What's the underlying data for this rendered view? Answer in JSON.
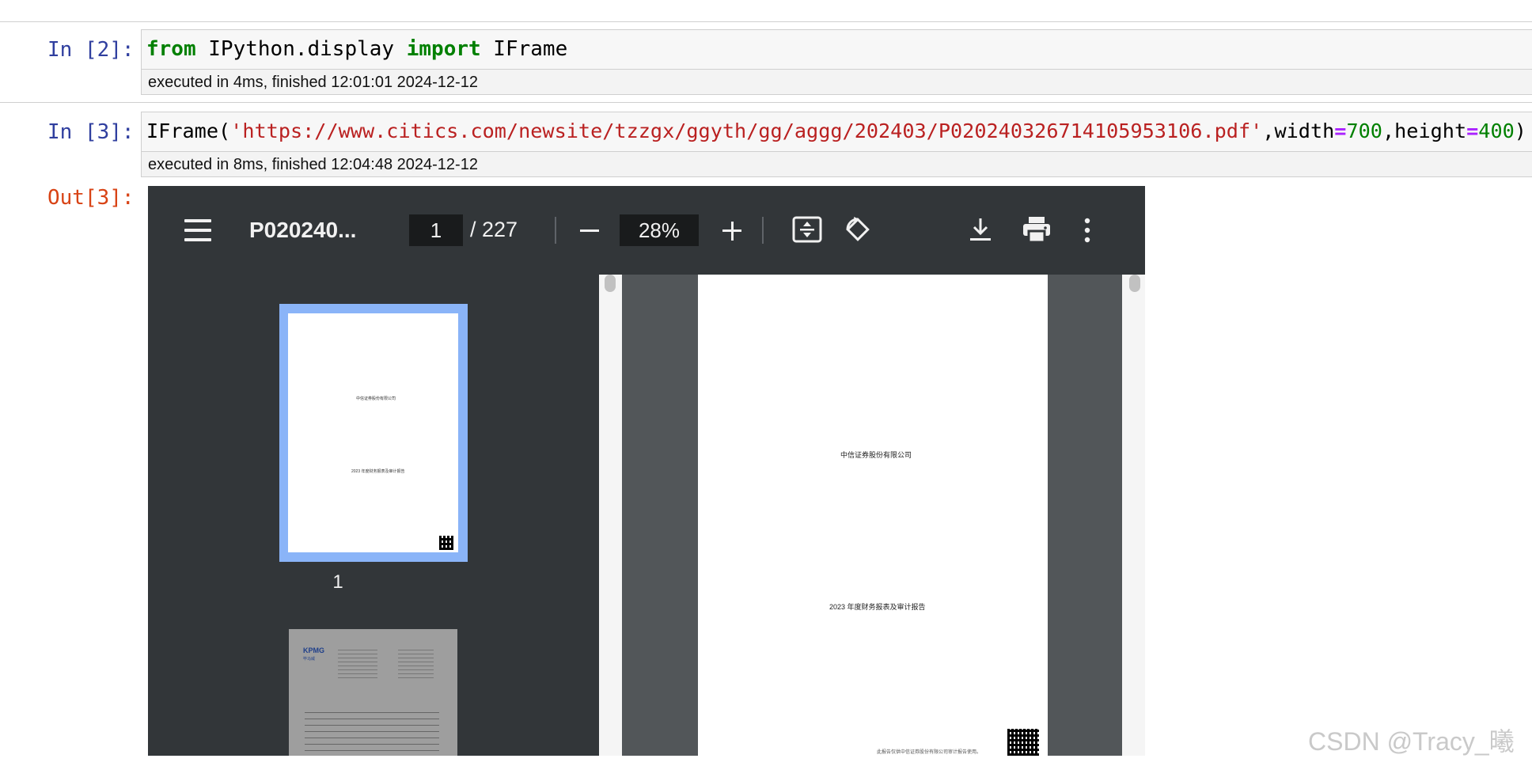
{
  "cells": [
    {
      "prompt": "In [2]:",
      "code": {
        "kw1": "from",
        "module": " IPython.display ",
        "kw2": "import",
        "name": " IFrame"
      },
      "exec": "executed in 4ms, finished 12:01:01 2024-12-12"
    },
    {
      "prompt": "In [3]:",
      "code": {
        "fn": "IFrame(",
        "url": "'https://www.citics.com/newsite/tzzgx/ggyth/gg/aggg/202403/P020240326714105953106.pdf'",
        "p1": ",width",
        "eq1": "=",
        "v1": "700",
        "p2": ",height",
        "eq2": "=",
        "v2": "400",
        "close": ")"
      },
      "exec": "executed in 8ms, finished 12:04:48 2024-12-12",
      "out_prompt": "Out[3]:"
    }
  ],
  "viewer": {
    "title": "P020240...",
    "page_current": "1",
    "page_total": "/ 227",
    "zoom": "28%",
    "thumb1_label": "1",
    "page_company": "中信证券股份有限公司",
    "page_report": "2023 年度财务报表及审计报告",
    "footer_note": "此报告仅供中信证券股份有限公司审计报告使用。"
  },
  "thumb2": {
    "logo": "KPMG",
    "logo_sub": "毕马威"
  },
  "watermark": "CSDN @Tracy_曦",
  "icons": [
    "menu-icon",
    "fit-page-icon",
    "rotate-icon",
    "download-icon",
    "print-icon",
    "more-vert-icon"
  ]
}
